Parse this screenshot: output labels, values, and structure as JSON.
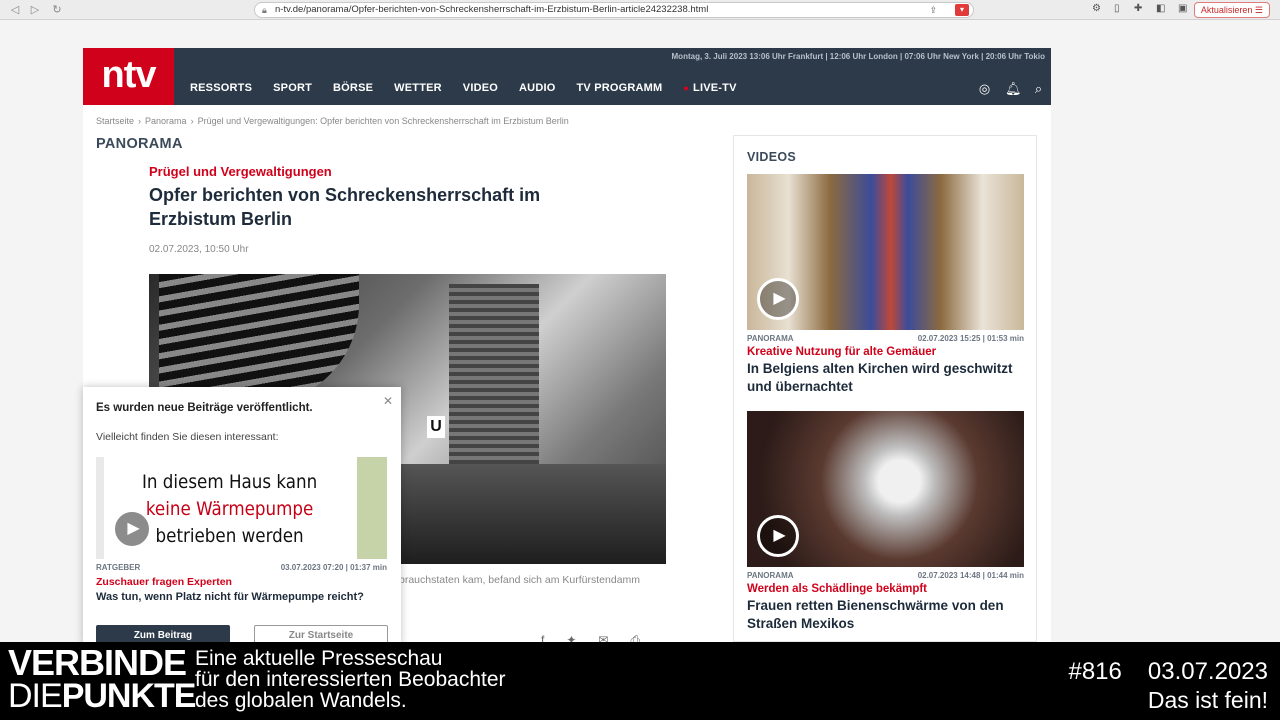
{
  "browser": {
    "url": "n-tv.de/panorama/Opfer-berichten-von-Schreckensherrschaft-im-Erzbistum-Berlin-article24232238.html",
    "update_button": "Aktualisieren ☰"
  },
  "header": {
    "logo": "ntv",
    "ticker": "Montag, 3. Juli 2023 13:06 Uhr Frankfurt | 12:06 Uhr London | 07:06 Uhr New York | 20:06 Uhr Tokio",
    "nav": [
      "RESSORTS",
      "SPORT",
      "BÖRSE",
      "WETTER",
      "VIDEO",
      "AUDIO",
      "TV PROGRAMM"
    ],
    "live": "LIVE-TV"
  },
  "breadcrumb": [
    "Startseite",
    "Panorama",
    "Prügel und Vergewaltigungen: Opfer berichten von Schreckensherrschaft im Erzbistum Berlin"
  ],
  "article": {
    "section": "PANORAMA",
    "kicker": "Prügel und Vergewaltigungen",
    "headline": "Opfer berichten von Schreckensherrschaft im Erzbistum Berlin",
    "date": "02.07.2023, 10:50 Uhr",
    "caption": "brauchstaten kam, befand sich am Kurfürstendamm"
  },
  "sidebar": {
    "title": "VIDEOS",
    "videos": [
      {
        "section": "PANORAMA",
        "meta": "02.07.2023 15:25 | 01:53 min",
        "kicker": "Kreative Nutzung für alte Gemäuer",
        "title": "In Belgiens alten Kirchen wird geschwitzt und übernachtet"
      },
      {
        "section": "PANORAMA",
        "meta": "02.07.2023 14:48 | 01:44 min",
        "kicker": "Werden als Schädlinge bekämpft",
        "title": "Frauen retten Bienenschwärme von den Straßen Mexikos"
      }
    ]
  },
  "popup": {
    "title": "Es wurden neue Beiträge veröffentlicht.",
    "subtitle": "Vielleicht finden Sie diesen interessant:",
    "thumb_line1": "In diesem Haus kann",
    "thumb_line2": "keine Wärmepumpe",
    "thumb_line3": "betrieben werden",
    "section": "RATGEBER",
    "meta": "03.07.2023 07:20 | 01:37 min",
    "kicker": "Zuschauer fragen Experten",
    "headline": "Was tun, wenn Platz nicht für Wärmepumpe reicht?",
    "btn_primary": "Zum Beitrag",
    "btn_secondary": "Zur Startseite"
  },
  "banner": {
    "brand_line1": "VERBINDE",
    "brand_line2a": "DIE",
    "brand_line2b": "PUNKTE",
    "tagline1": "Eine aktuelle Presseschau",
    "tagline2": "für den interessierten Beobachter",
    "tagline3": "des globalen Wandels.",
    "episode": "#816",
    "date": "03.07.2023",
    "slogan": "Das ist fein!"
  }
}
